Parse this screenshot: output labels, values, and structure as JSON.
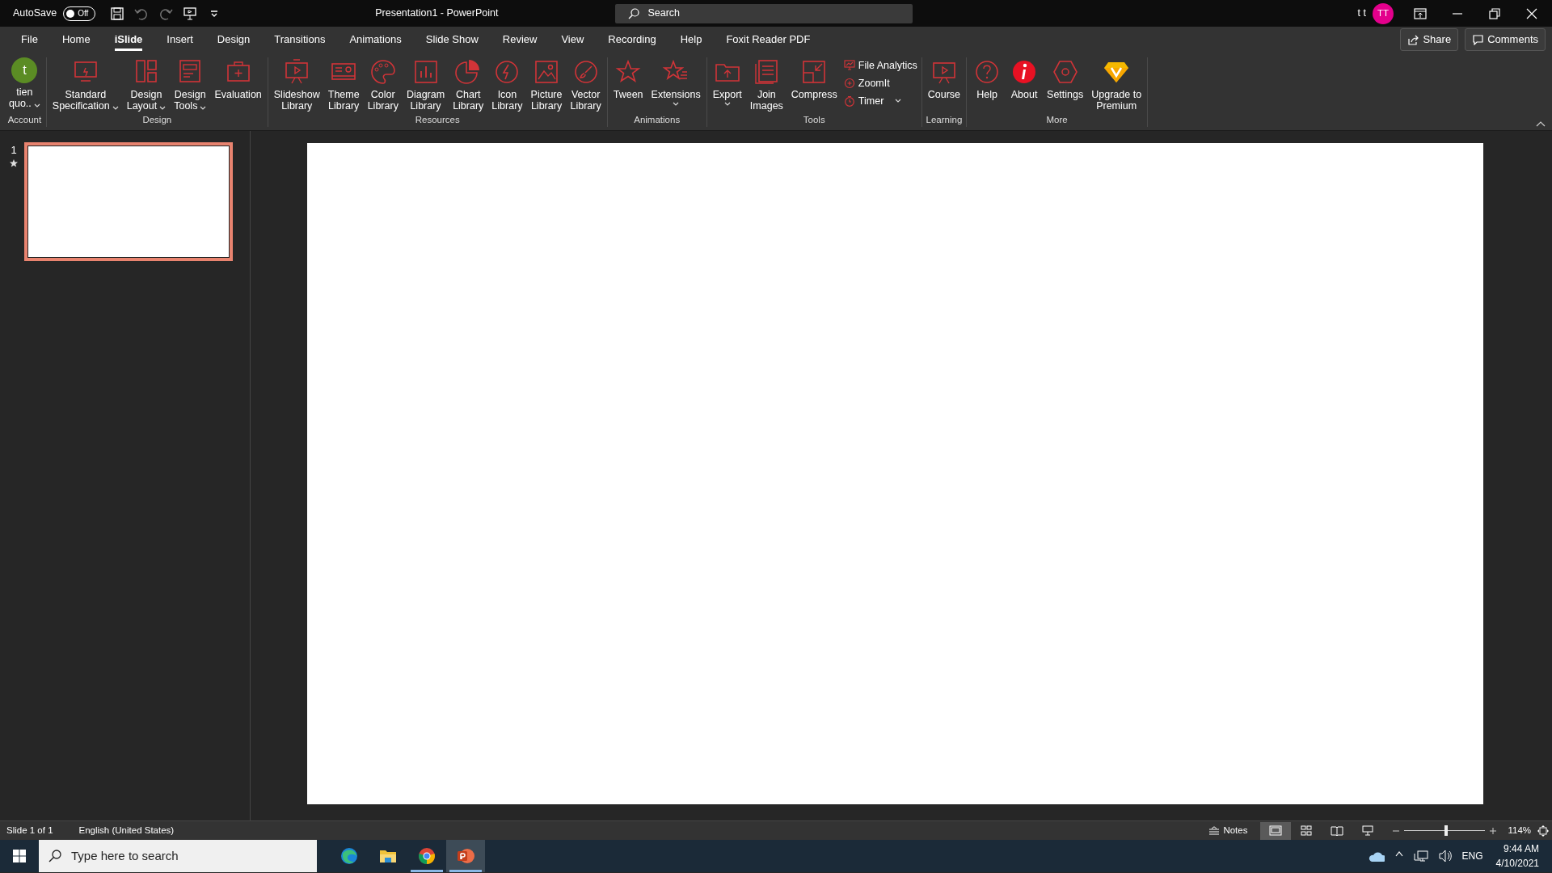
{
  "title_bar": {
    "autosave_label": "AutoSave",
    "autosave": {
      "on": false,
      "label": "Off"
    },
    "title": "Presentation1  -  PowerPoint",
    "search_placeholder": "Search",
    "user_name": "t t",
    "avatar": "TT"
  },
  "tabs": [
    {
      "label": "File",
      "selected": false
    },
    {
      "label": "Home",
      "selected": false
    },
    {
      "label": "iSlide",
      "selected": true
    },
    {
      "label": "Insert",
      "selected": false
    },
    {
      "label": "Design",
      "selected": false
    },
    {
      "label": "Transitions",
      "selected": false
    },
    {
      "label": "Animations",
      "selected": false
    },
    {
      "label": "Slide Show",
      "selected": false
    },
    {
      "label": "Review",
      "selected": false
    },
    {
      "label": "View",
      "selected": false
    },
    {
      "label": "Recording",
      "selected": false
    },
    {
      "label": "Help",
      "selected": false
    },
    {
      "label": "Foxit Reader PDF",
      "selected": false
    }
  ],
  "actions": [
    "Share",
    "Comments"
  ],
  "ribbon": [
    {
      "name": "Account",
      "items": [
        {
          "kind": "avatar",
          "letter": "t",
          "label": "tien\nquo..",
          "dropdown": true
        }
      ]
    },
    {
      "name": "Design",
      "items": [
        {
          "kind": "big",
          "label": "Standard\nSpecification",
          "dropdown": true
        },
        {
          "kind": "big",
          "label": "Design\nLayout",
          "dropdown": true
        },
        {
          "kind": "big",
          "label": "Design\nTools",
          "dropdown": true
        },
        {
          "kind": "big",
          "label": "Evaluation",
          "dropdown": false
        }
      ]
    },
    {
      "name": "Resources",
      "items": [
        {
          "kind": "big",
          "label": "Slideshow\nLibrary",
          "dropdown": false
        },
        {
          "kind": "big",
          "label": "Theme\nLibrary",
          "dropdown": false
        },
        {
          "kind": "big",
          "label": "Color\nLibrary",
          "dropdown": false
        },
        {
          "kind": "big",
          "label": "Diagram\nLibrary",
          "dropdown": false
        },
        {
          "kind": "big",
          "label": "Chart\nLibrary",
          "dropdown": false
        },
        {
          "kind": "big",
          "label": "Icon\nLibrary",
          "dropdown": false
        },
        {
          "kind": "big",
          "label": "Picture\nLibrary",
          "dropdown": false
        },
        {
          "kind": "big",
          "label": "Vector\nLibrary",
          "dropdown": false
        }
      ]
    },
    {
      "name": "Animations",
      "items": [
        {
          "kind": "big",
          "label": "Tween",
          "dropdown": false
        },
        {
          "kind": "big",
          "label": "Extensions",
          "dropdown": true
        }
      ]
    },
    {
      "name": "Tools",
      "items": [
        {
          "kind": "big",
          "label": "Export",
          "dropdown": true
        },
        {
          "kind": "big",
          "label": "Join\nImages",
          "dropdown": false
        },
        {
          "kind": "big",
          "label": "Compress",
          "dropdown": false
        },
        {
          "kind": "small",
          "label": "File Analytics",
          "dropdown": false
        },
        {
          "kind": "small",
          "label": "ZoomIt",
          "dropdown": false
        },
        {
          "kind": "small",
          "label": "Timer",
          "dropdown": true
        }
      ]
    },
    {
      "name": "Learning",
      "items": [
        {
          "kind": "big",
          "label": "Course",
          "dropdown": false
        }
      ]
    },
    {
      "name": "More",
      "items": [
        {
          "kind": "big",
          "label": "Help",
          "dropdown": false
        },
        {
          "kind": "big",
          "label": "About",
          "dropdown": false
        },
        {
          "kind": "big",
          "label": "Settings",
          "dropdown": false
        },
        {
          "kind": "big",
          "label": "Upgrade to\nPremium",
          "dropdown": false
        }
      ]
    }
  ],
  "slides": [
    {
      "number": "1",
      "selected": true,
      "animated": true
    }
  ],
  "status_bar": {
    "slide": "Slide 1 of 1",
    "language": "English (United States)",
    "notes": "Notes",
    "views": [
      {
        "selected": true
      },
      {
        "selected": false
      },
      {
        "selected": false
      },
      {
        "selected": false
      }
    ],
    "zoom_slider": {
      "level": 0.52
    },
    "zoom": "114%"
  },
  "taskbar": {
    "search_placeholder": "Type here to search",
    "apps": [
      {
        "running": false,
        "selected": false
      },
      {
        "running": false,
        "selected": false
      },
      {
        "running": true,
        "selected": false
      },
      {
        "running": true,
        "selected": true
      }
    ],
    "language": "ENG",
    "time": "9:44 AM",
    "date": "4/10/2021"
  }
}
